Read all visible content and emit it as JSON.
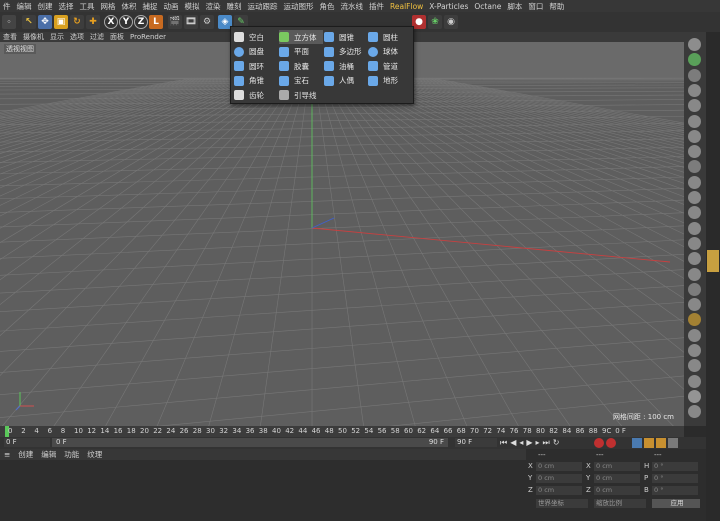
{
  "menubar": [
    "件",
    "编辑",
    "创建",
    "选择",
    "工具",
    "网格",
    "体积",
    "捕捉",
    "动画",
    "模拟",
    "渲染",
    "雕刻",
    "运动跟踪",
    "运动图形",
    "角色",
    "流水线",
    "插件",
    "RealFlow",
    "X-Particles",
    "Octane",
    "脚本",
    "窗口",
    "帮助"
  ],
  "toolbar": {
    "x": "X",
    "y": "Y",
    "z": "Z"
  },
  "viewport_menu": [
    "查看",
    "摄像机",
    "显示",
    "选项",
    "过滤",
    "面板",
    "ProRender"
  ],
  "viewport_label": "透视视图",
  "grid_info": "网格间距 : 100 cm",
  "popup": {
    "col1": [
      {
        "label": "空白",
        "icon": "null-icon"
      },
      {
        "label": "圆盘",
        "icon": "disc-icon"
      },
      {
        "label": "圆环",
        "icon": "torus-icon"
      },
      {
        "label": "角锥",
        "icon": "pyramid-icon"
      },
      {
        "label": "齿轮",
        "icon": "gear-icon"
      }
    ],
    "col2": [
      {
        "label": "立方体",
        "icon": "cube-icon",
        "selected": true
      },
      {
        "label": "平面",
        "icon": "plane-icon"
      },
      {
        "label": "胶囊",
        "icon": "capsule-icon"
      },
      {
        "label": "宝石",
        "icon": "gem-icon"
      },
      {
        "label": "引导线",
        "icon": "guide-icon"
      }
    ],
    "col3": [
      {
        "label": "圆锥",
        "icon": "cone-icon"
      },
      {
        "label": "多边形",
        "icon": "polygon-icon"
      },
      {
        "label": "油桶",
        "icon": "oil-tank-icon"
      },
      {
        "label": "人偶",
        "icon": "figure-icon"
      }
    ],
    "col4": [
      {
        "label": "圆柱",
        "icon": "cylinder-icon"
      },
      {
        "label": "球体",
        "icon": "sphere-icon"
      },
      {
        "label": "管道",
        "icon": "tube-icon"
      },
      {
        "label": "地形",
        "icon": "landscape-icon"
      }
    ]
  },
  "ruler": [
    "0",
    "2",
    "4",
    "6",
    "8",
    "10",
    "12",
    "14",
    "16",
    "18",
    "20",
    "22",
    "24",
    "26",
    "28",
    "30",
    "32",
    "34",
    "36",
    "38",
    "40",
    "42",
    "44",
    "46",
    "48",
    "50",
    "52",
    "54",
    "56",
    "58",
    "60",
    "62",
    "64",
    "66",
    "68",
    "70",
    "72",
    "74",
    "76",
    "78",
    "80",
    "82",
    "84",
    "86",
    "88",
    "9C",
    "0 F"
  ],
  "timeline": {
    "start": "0 F",
    "current": "0 F",
    "end_a": "90 F",
    "end_b": "90 F"
  },
  "bottom_menu": [
    "创建",
    "编辑",
    "功能",
    "纹理"
  ],
  "coords": {
    "header": [
      "---",
      "---",
      "---"
    ],
    "rows": [
      {
        "axis": "X",
        "pos": "0 cm",
        "axis2": "X",
        "size": "0 cm",
        "rot_axis": "H",
        "rot": "0 °"
      },
      {
        "axis": "Y",
        "pos": "0 cm",
        "axis2": "Y",
        "size": "0 cm",
        "rot_axis": "P",
        "rot": "0 °"
      },
      {
        "axis": "Z",
        "pos": "0 cm",
        "axis2": "Z",
        "size": "0 cm",
        "rot_axis": "B",
        "rot": "0 °"
      }
    ],
    "mode_world": "世界坐标",
    "mode_scale": "缩放比例",
    "apply": "应用"
  },
  "colors": {
    "accent": "#f0c040",
    "popup_bg": "#383838",
    "viewport_bg": "#5e5e5e"
  }
}
